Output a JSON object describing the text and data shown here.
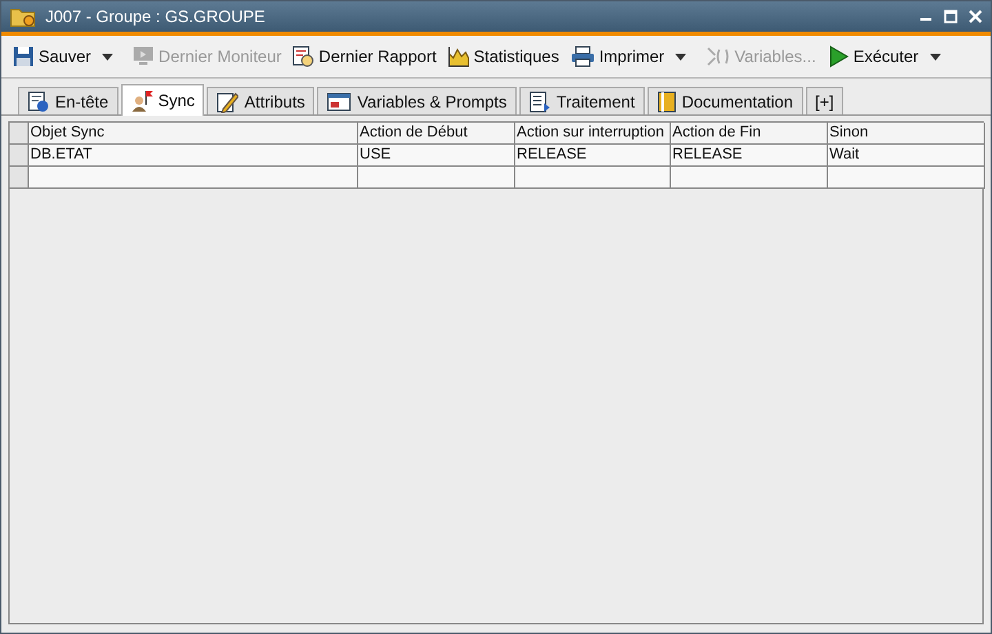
{
  "window": {
    "title": "J007 - Groupe : GS.GROUPE"
  },
  "toolbar": [
    {
      "label": "Sauver",
      "disabled": false,
      "dropdown": true
    },
    {
      "label": "Dernier Moniteur",
      "disabled": true,
      "dropdown": false
    },
    {
      "label": "Dernier Rapport",
      "disabled": false,
      "dropdown": false
    },
    {
      "label": "Statistiques",
      "disabled": false,
      "dropdown": false
    },
    {
      "label": "Imprimer",
      "disabled": false,
      "dropdown": true
    },
    {
      "label": "Variables...",
      "disabled": true,
      "dropdown": false
    },
    {
      "label": "Exécuter",
      "disabled": false,
      "dropdown": true
    }
  ],
  "tabs": [
    {
      "label": "En-tête",
      "selected": false
    },
    {
      "label": "Sync",
      "selected": true
    },
    {
      "label": "Attributs",
      "selected": false
    },
    {
      "label": "Variables & Prompts",
      "selected": false
    },
    {
      "label": "Traitement",
      "selected": false
    },
    {
      "label": "Documentation",
      "selected": false
    },
    {
      "label": "[+]",
      "selected": false
    }
  ],
  "table": {
    "columns": [
      "Objet Sync",
      "Action de Début",
      "Action sur interruption",
      "Action de Fin",
      "Sinon"
    ],
    "rows": [
      [
        "DB.ETAT",
        "USE",
        "RELEASE",
        "RELEASE",
        "Wait"
      ],
      [
        "",
        "",
        "",
        "",
        ""
      ]
    ]
  }
}
